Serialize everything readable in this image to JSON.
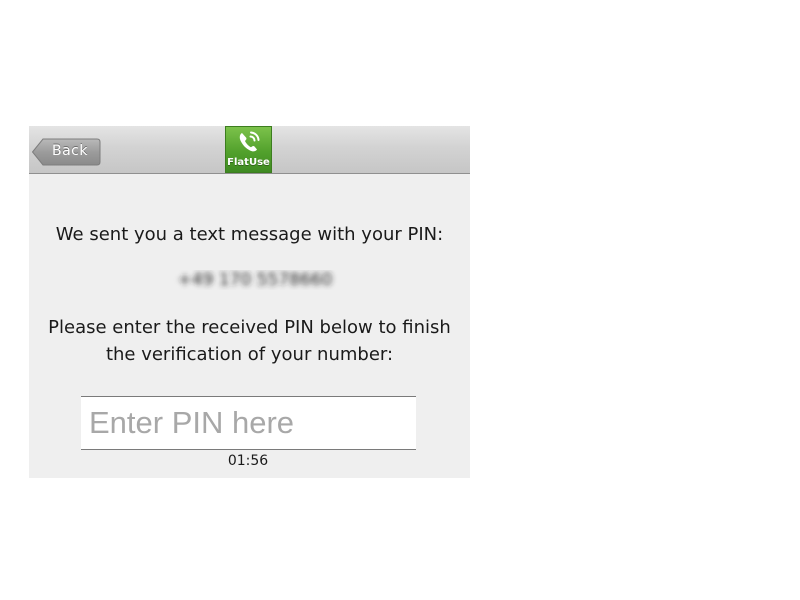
{
  "header": {
    "back_label": "Back",
    "logo_text": "FlatUse",
    "logo_icon": "phone-call-icon",
    "brand_color": "#52a12c"
  },
  "main": {
    "message": "We sent you a text message with your PIN:",
    "phone_number_obscured": "+49 170 5578660",
    "instruction_line1": "Please enter the received PIN below to finish",
    "instruction_line2": "the verification of your number:",
    "pin_placeholder": "Enter PIN here",
    "pin_value": "",
    "timer": "01:56"
  }
}
